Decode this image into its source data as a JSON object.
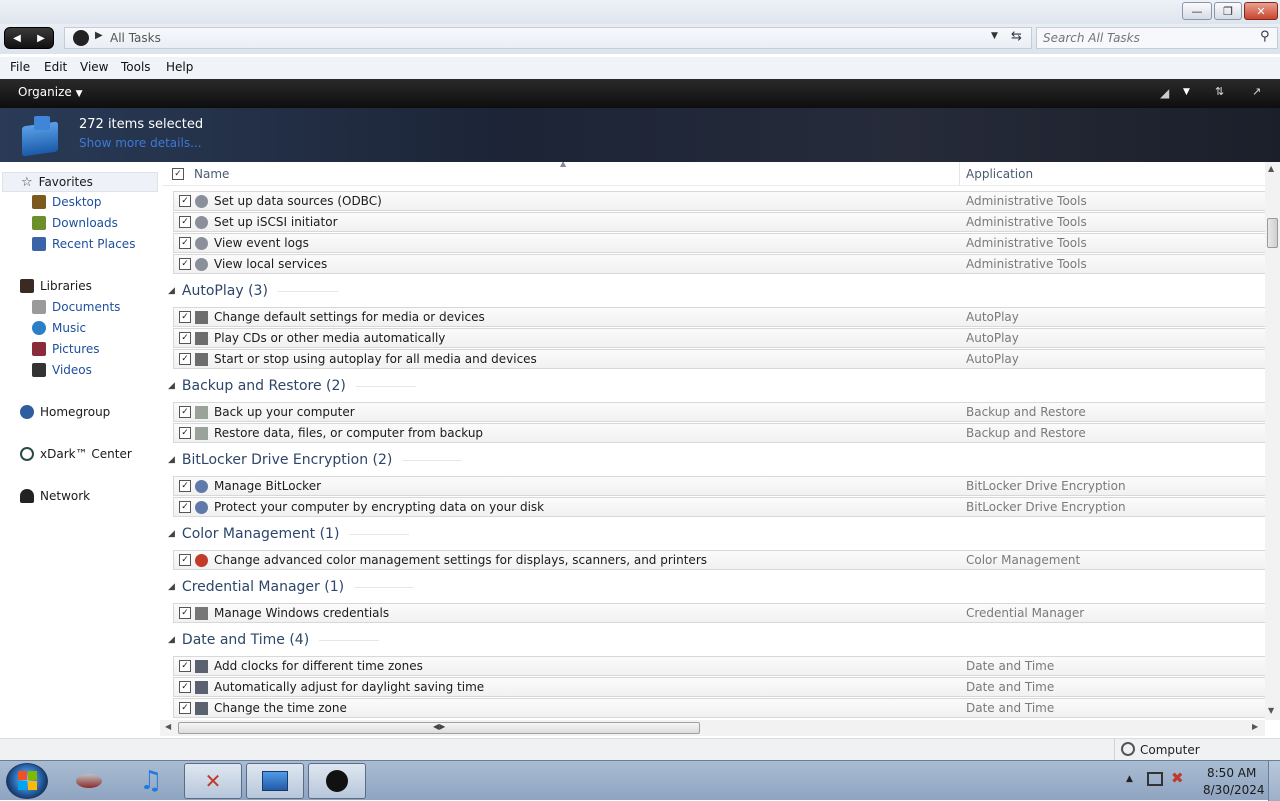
{
  "window": {
    "minimize_icon": "minimize-icon",
    "maximize_icon": "restore-icon",
    "close_icon": "close-icon"
  },
  "address": {
    "breadcrumb": "All Tasks",
    "search_placeholder": "Search All Tasks"
  },
  "menu": [
    "File",
    "Edit",
    "View",
    "Tools",
    "Help"
  ],
  "toolbar": {
    "organize": "Organize"
  },
  "details": {
    "count": "272 items selected",
    "more": "Show more details..."
  },
  "nav": {
    "favorites": "Favorites",
    "favorites_items": [
      "Desktop",
      "Downloads",
      "Recent Places"
    ],
    "libraries": "Libraries",
    "libraries_items": [
      "Documents",
      "Music",
      "Pictures",
      "Videos"
    ],
    "homegroup": "Homegroup",
    "xdark": "xDark™ Center",
    "network": "Network"
  },
  "columns": {
    "name": "Name",
    "application": "Application"
  },
  "list": {
    "admin_rows": [
      {
        "name": "Set up data sources (ODBC)",
        "app": "Administrative Tools"
      },
      {
        "name": "Set up iSCSI initiator",
        "app": "Administrative Tools"
      },
      {
        "name": "View event logs",
        "app": "Administrative Tools"
      },
      {
        "name": "View local services",
        "app": "Administrative Tools"
      }
    ],
    "groups": [
      {
        "title": "AutoPlay (3)",
        "rows": [
          {
            "name": "Change default settings for media or devices",
            "app": "AutoPlay"
          },
          {
            "name": "Play CDs or other media automatically",
            "app": "AutoPlay"
          },
          {
            "name": "Start or stop using autoplay for all media and devices",
            "app": "AutoPlay"
          }
        ]
      },
      {
        "title": "Backup and Restore (2)",
        "rows": [
          {
            "name": "Back up your computer",
            "app": "Backup and Restore"
          },
          {
            "name": "Restore data, files, or computer from backup",
            "app": "Backup and Restore"
          }
        ]
      },
      {
        "title": "BitLocker Drive Encryption (2)",
        "rows": [
          {
            "name": "Manage BitLocker",
            "app": "BitLocker Drive Encryption"
          },
          {
            "name": "Protect your computer by encrypting data on your disk",
            "app": "BitLocker Drive Encryption"
          }
        ]
      },
      {
        "title": "Color Management (1)",
        "rows": [
          {
            "name": "Change advanced color management settings for displays, scanners, and printers",
            "app": "Color Management"
          }
        ]
      },
      {
        "title": "Credential Manager (1)",
        "rows": [
          {
            "name": "Manage Windows credentials",
            "app": "Credential Manager"
          }
        ]
      },
      {
        "title": "Date and Time (4)",
        "rows": [
          {
            "name": "Add clocks for different time zones",
            "app": "Date and Time"
          },
          {
            "name": "Automatically adjust for daylight saving time",
            "app": "Date and Time"
          },
          {
            "name": "Change the time zone",
            "app": "Date and Time"
          }
        ]
      }
    ]
  },
  "status": {
    "location": "Computer"
  },
  "taskbar": {
    "time": "8:50 AM",
    "date": "8/30/2024"
  },
  "colors": {
    "accent_link": "#1c4f9c",
    "group_header": "#2d4669",
    "toolbar_bg": "#111111"
  }
}
